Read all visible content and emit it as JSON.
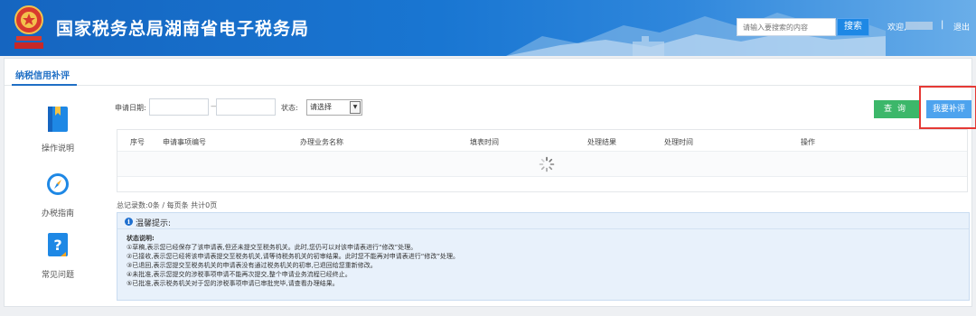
{
  "header": {
    "site_title": "国家税务总局湖南省电子税务局",
    "search_placeholder": "请输入要搜索的内容",
    "search_button": "搜索",
    "welcome": "欢迎,",
    "separator": "|",
    "logout": "退出"
  },
  "tabs": [
    {
      "label": "纳税信用补评",
      "active": true
    }
  ],
  "sidebar": {
    "items": [
      {
        "label": "操作说明",
        "icon": "book-icon"
      },
      {
        "label": "办税指南",
        "icon": "compass-icon"
      },
      {
        "label": "常见问题",
        "icon": "question-icon"
      }
    ]
  },
  "filters": {
    "date_label": "申请日期:",
    "date_separator": "—",
    "date_from": "",
    "date_to": "",
    "status_label": "状态:",
    "status_value": "请选择"
  },
  "actions": {
    "query": "查询",
    "apply": "我要补评"
  },
  "table": {
    "columns": [
      "序号",
      "申请事项编号",
      "办理业务名称",
      "填表时间",
      "处理结果",
      "处理时间",
      "操作"
    ],
    "rows": []
  },
  "summary": "总记录数:0条 / 每页条 共计0页",
  "notice": {
    "title": "温馨提示:",
    "subtitle": "状态说明:",
    "lines": [
      "①草稿,表示您已经保存了该申请表,但还未提交至税务机关。此时,您仍可以对该申请表进行“修改”处理。",
      "②已接收,表示您已经将该申请表提交至税务机关,请等待税务机关的初审结果。此时您不能再对申请表进行“修改”处理。",
      "③已退回,表示您提交至税务机关的申请表没有通过税务机关的初审,已退回给您重新修改。",
      "④未批准,表示您提交的涉税事项申请不能再次提交,整个申请业务流程已经终止。",
      "⑤已批准,表示税务机关对于您的涉税事项申请已审批完毕,请查看办理结果。"
    ]
  },
  "colors": {
    "header_blue": "#1976d2",
    "query_green": "#3cb76a",
    "apply_blue": "#4da3ee",
    "highlight_red": "#e53935"
  }
}
